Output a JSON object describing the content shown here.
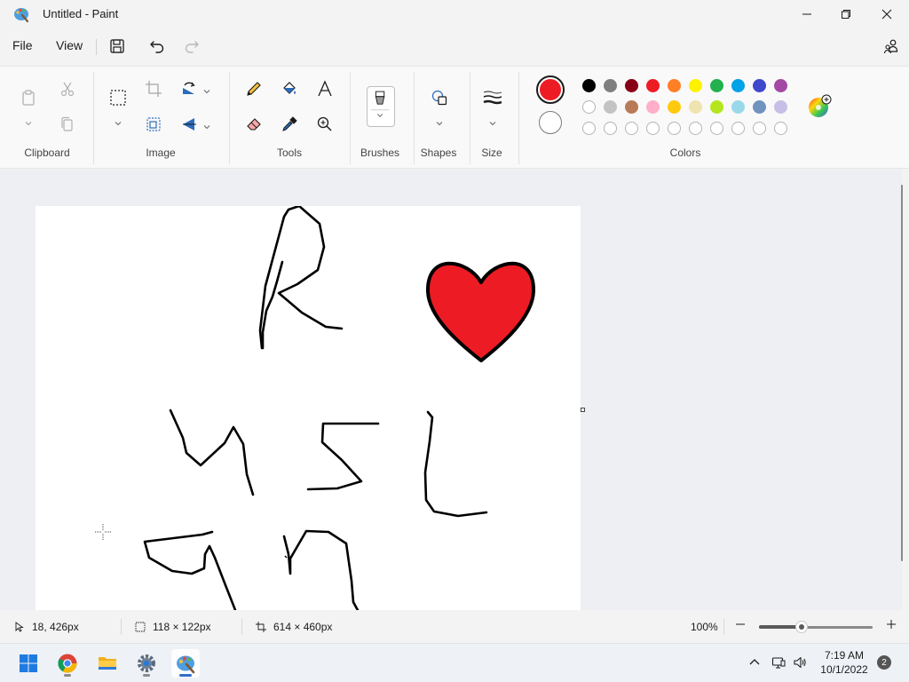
{
  "window": {
    "title": "Untitled - Paint"
  },
  "menu": {
    "file": "File",
    "view": "View"
  },
  "ribbon": {
    "groups": {
      "clipboard": "Clipboard",
      "image": "Image",
      "tools": "Tools",
      "brushes": "Brushes",
      "shapes": "Shapes",
      "size": "Size",
      "colors": "Colors"
    },
    "current_color_primary": "#ed1c24",
    "current_color_secondary": "#ffffff",
    "palette_row1": [
      "#000000",
      "#7f7f7f",
      "#880015",
      "#ed1c24",
      "#ff7f27",
      "#fff200",
      "#22b14c",
      "#00a2e8",
      "#3f48cc",
      "#a349a4"
    ],
    "palette_row2": [
      "#ffffff",
      "#c3c3c3",
      "#b97a57",
      "#ffaec9",
      "#ffc90e",
      "#efe4b0",
      "#b5e61d",
      "#99d9ea",
      "#7092be",
      "#c8bfe7"
    ],
    "palette_row3_empty": 10
  },
  "canvas": {
    "drawing": {
      "stroke_color": "#000000",
      "heart_fill": "#ed1c24"
    }
  },
  "status": {
    "cursor_pos": "18, 426px",
    "selection_size": "118 × 122px",
    "canvas_size": "614 × 460px",
    "zoom": "100%",
    "zoom_level_fraction": 0.375
  },
  "taskbar": {
    "apps": [
      "start-icon",
      "chrome-icon",
      "file-explorer-icon",
      "settings-icon",
      "paint-icon"
    ],
    "time": "7:19 AM",
    "date": "10/1/2022",
    "notifications": "2"
  }
}
